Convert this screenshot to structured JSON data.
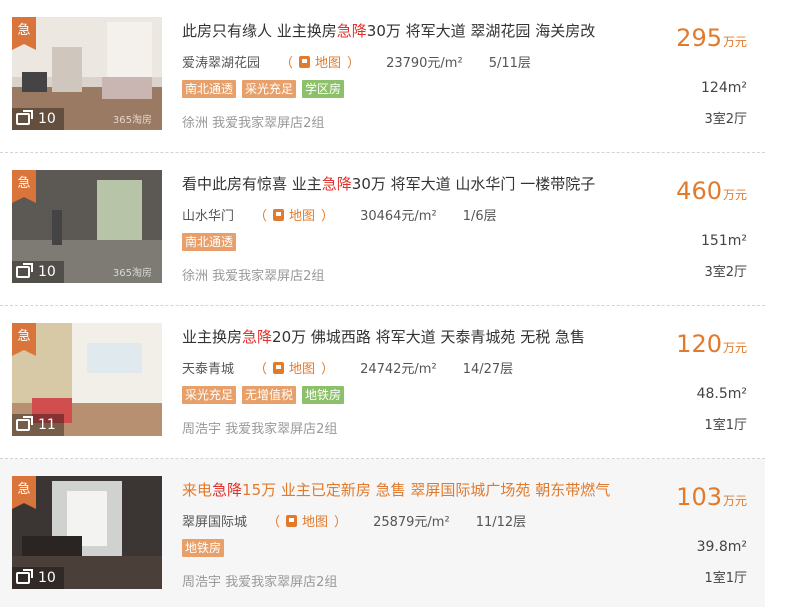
{
  "listings": [
    {
      "badge": "急",
      "photo_count": "10",
      "watermark": "365淘房",
      "title_before": "此房只有缘人 业主换房",
      "title_hot": "急降",
      "title_after": "30万 将军大道 翠湖花园 海关房改",
      "community": "爱涛翠湖花园",
      "map_label": "地图",
      "unit_price": "23790元/m²",
      "floor": "5/11层",
      "tags": [
        {
          "label": "南北通透",
          "color": "#e8a06a"
        },
        {
          "label": "采光充足",
          "color": "#e8a06a"
        },
        {
          "label": "学区房",
          "color": "#8cc06a"
        }
      ],
      "agent": "徐洲 我爱我家翠屏店2组",
      "price": "295",
      "price_unit": "万元",
      "area": "124m²",
      "layout": "3室2厅"
    },
    {
      "badge": "急",
      "photo_count": "10",
      "watermark": "365淘房",
      "title_before": "看中此房有惊喜 业主",
      "title_hot": "急降",
      "title_after": "30万 将军大道 山水华门 一楼带院子",
      "community": "山水华门",
      "map_label": "地图",
      "unit_price": "30464元/m²",
      "floor": "1/6层",
      "tags": [
        {
          "label": "南北通透",
          "color": "#e8a06a"
        }
      ],
      "agent": "徐洲 我爱我家翠屏店2组",
      "price": "460",
      "price_unit": "万元",
      "area": "151m²",
      "layout": "3室2厅"
    },
    {
      "badge": "急",
      "photo_count": "11",
      "watermark": "",
      "title_before": "业主换房",
      "title_hot": "急降",
      "title_after": "20万 佛城西路 将军大道 天泰青城苑 无税 急售",
      "community": "天泰青城",
      "map_label": "地图",
      "unit_price": "24742元/m²",
      "floor": "14/27层",
      "tags": [
        {
          "label": "采光充足",
          "color": "#e8a06a"
        },
        {
          "label": "无增值税",
          "color": "#e8a06a"
        },
        {
          "label": "地铁房",
          "color": "#8cc06a"
        }
      ],
      "agent": "周浩宇 我爱我家翠屏店2组",
      "price": "120",
      "price_unit": "万元",
      "area": "48.5m²",
      "layout": "1室1厅"
    },
    {
      "badge": "急",
      "photo_count": "10",
      "watermark": "",
      "title_before": "来电",
      "title_hot": "急降",
      "title_after": "15万 业主已定新房 急售 翠屏国际城广场苑 朝东带燃气",
      "community": "翠屏国际城",
      "map_label": "地图",
      "unit_price": "25879元/m²",
      "floor": "11/12层",
      "tags": [
        {
          "label": "地铁房",
          "color": "#e8a06a"
        }
      ],
      "agent": "周浩宇 我爱我家翠屏店2组",
      "price": "103",
      "price_unit": "万元",
      "area": "39.8m²",
      "layout": "1室1厅"
    }
  ],
  "colors": {
    "accent": "#e27a2c",
    "hot": "#e0312b",
    "highlight_row": "#f6f6f6"
  },
  "icons": {
    "map": "map-pin-icon",
    "photos": "photo-stack-icon"
  }
}
